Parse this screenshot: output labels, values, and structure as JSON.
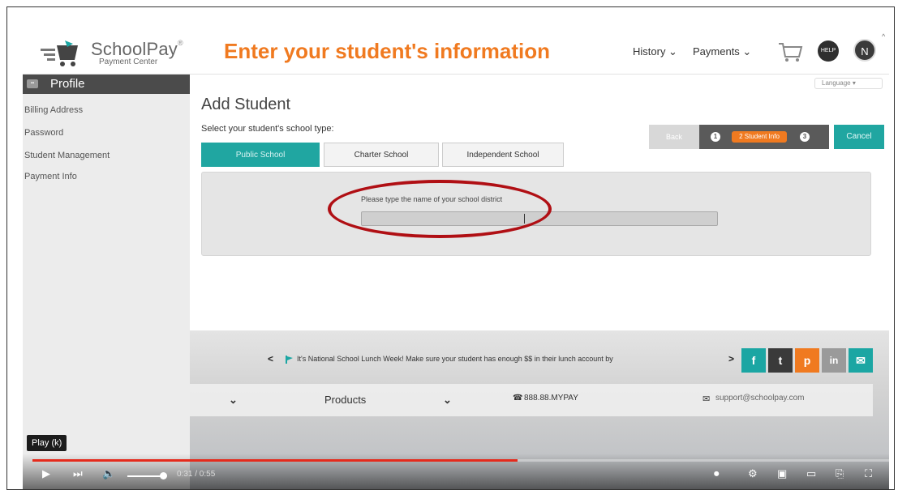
{
  "header": {
    "logo_main": "SchoolPay",
    "logo_reg": "®",
    "logo_sub": "Payment Center",
    "headline": "Enter your student's information",
    "nav_history": "History ⌄",
    "nav_payments": "Payments ⌄",
    "help_label": "HELP",
    "avatar_initial": "N"
  },
  "sidebar": {
    "title": "Profile",
    "badge": "▪▪",
    "items": [
      {
        "label": "Billing Address"
      },
      {
        "label": "Password"
      },
      {
        "label": "Student Management"
      },
      {
        "label": "Payment Info"
      }
    ]
  },
  "main": {
    "language": "Language ▾",
    "title": "Add Student",
    "subtitle": "Select your student's school type:",
    "tabs": [
      {
        "label": "Public School"
      },
      {
        "label": "Charter School"
      },
      {
        "label": "Independent School"
      }
    ],
    "wizard": {
      "back": "Back",
      "step1": "1",
      "current": "2 Student Info",
      "step3": "3",
      "cancel": "Cancel"
    },
    "prompt": "Please type the name of your school district",
    "district_value": ""
  },
  "footer": {
    "news": "It's National School Lunch Week! Make sure your student has enough $$ in their lunch account by",
    "left_arrow": "<",
    "right_arrow": ">",
    "social": [
      "f",
      "t",
      "p",
      "in",
      "✉"
    ],
    "chevron1": "⌄",
    "products": "Products",
    "chevron2": "⌄",
    "phone": "888.88.MYPAY",
    "email": "support@schoolpay.com"
  },
  "player": {
    "tooltip": "Play (k)",
    "time": "0:31 / 0:55",
    "progress": 0.563
  },
  "colors": {
    "accent_teal": "#20a6a1",
    "accent_orange": "#f07a20",
    "annotation_red": "#b00f14",
    "progress_red": "#e52a1c"
  }
}
